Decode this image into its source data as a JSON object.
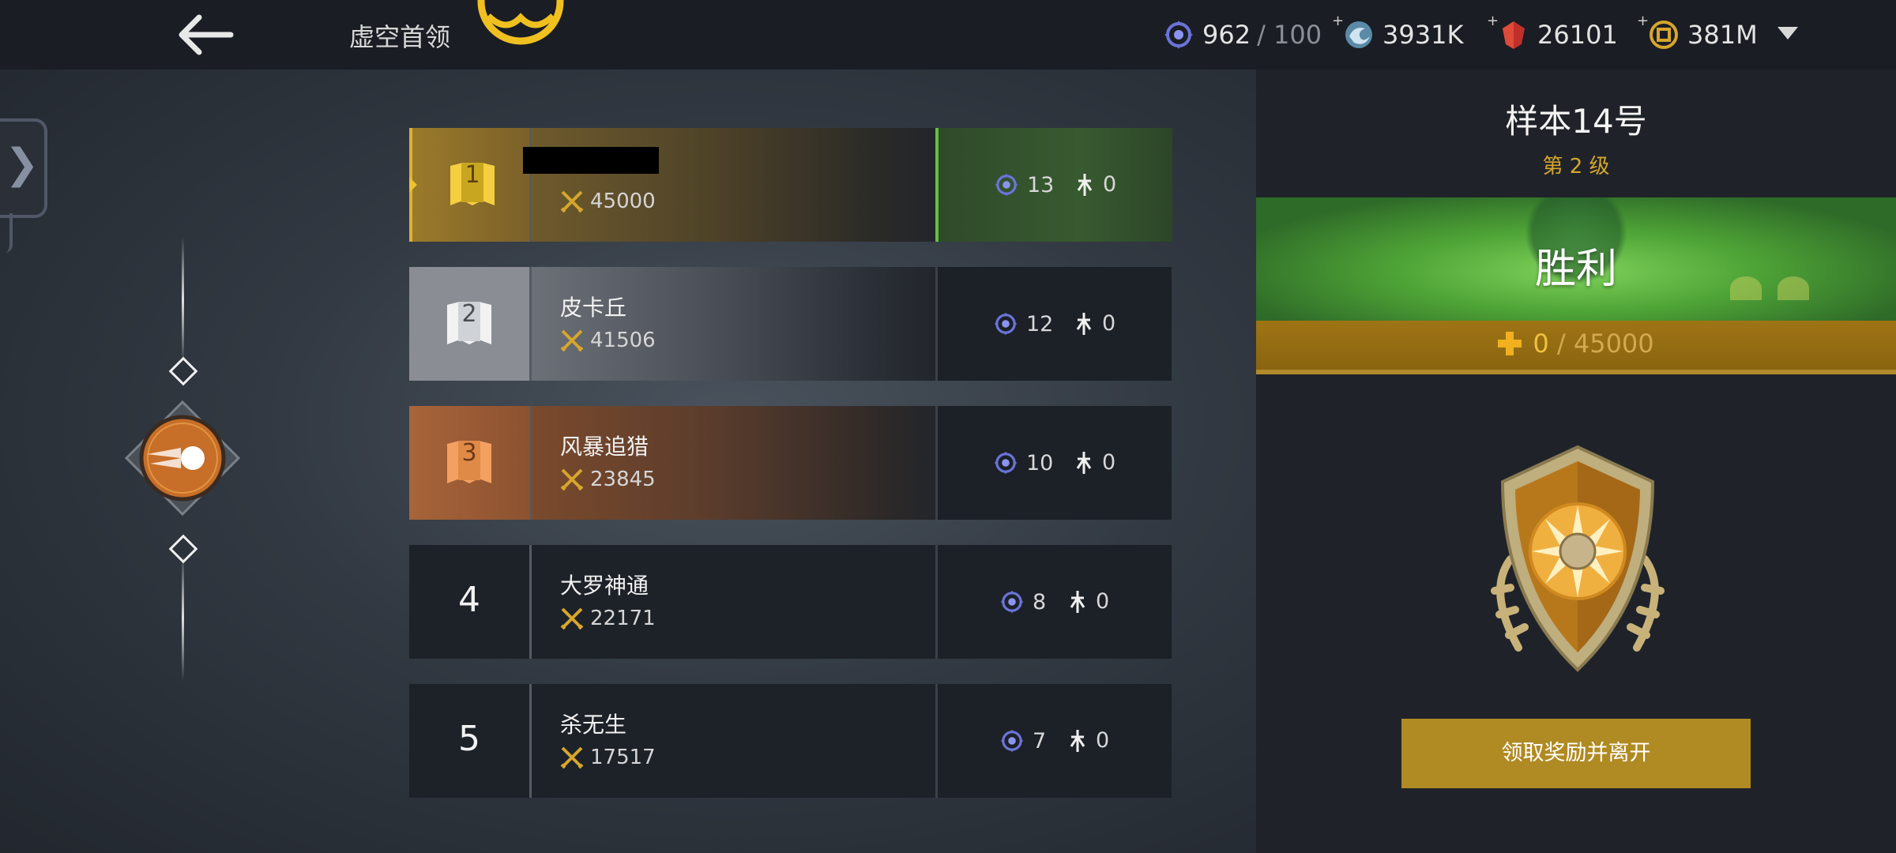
{
  "header": {
    "title": "虚空首领",
    "resources": [
      {
        "icon": "energy-icon",
        "value": "962",
        "suffix": "/ 100"
      },
      {
        "icon": "vortex-currency-icon",
        "value": "3931K"
      },
      {
        "icon": "red-crystal-icon",
        "value": "26101"
      },
      {
        "icon": "gold-coin-icon",
        "value": "381M"
      }
    ]
  },
  "leaderboard": [
    {
      "rank": "1",
      "name": "",
      "power": "45000",
      "energy": "13",
      "kills": "0"
    },
    {
      "rank": "2",
      "name": "皮卡丘",
      "power": "41506",
      "energy": "12",
      "kills": "0"
    },
    {
      "rank": "3",
      "name": "风暴追猎",
      "power": "23845",
      "energy": "10",
      "kills": "0"
    },
    {
      "rank": "4",
      "name": "大罗神通",
      "power": "22171",
      "energy": "8",
      "kills": "0"
    },
    {
      "rank": "5",
      "name": "杀无生",
      "power": "17517",
      "energy": "7",
      "kills": "0"
    }
  ],
  "result": {
    "stage_name": "样本14号",
    "stage_level": "第 2 级",
    "outcome": "胜利",
    "progress_current": "0",
    "progress_total": "/ 45000",
    "claim_label": "领取奖励并离开"
  },
  "colors": {
    "accent_gold": "#d6a62c",
    "victory_green": "#4ea336",
    "button_gold": "#b08a22"
  }
}
